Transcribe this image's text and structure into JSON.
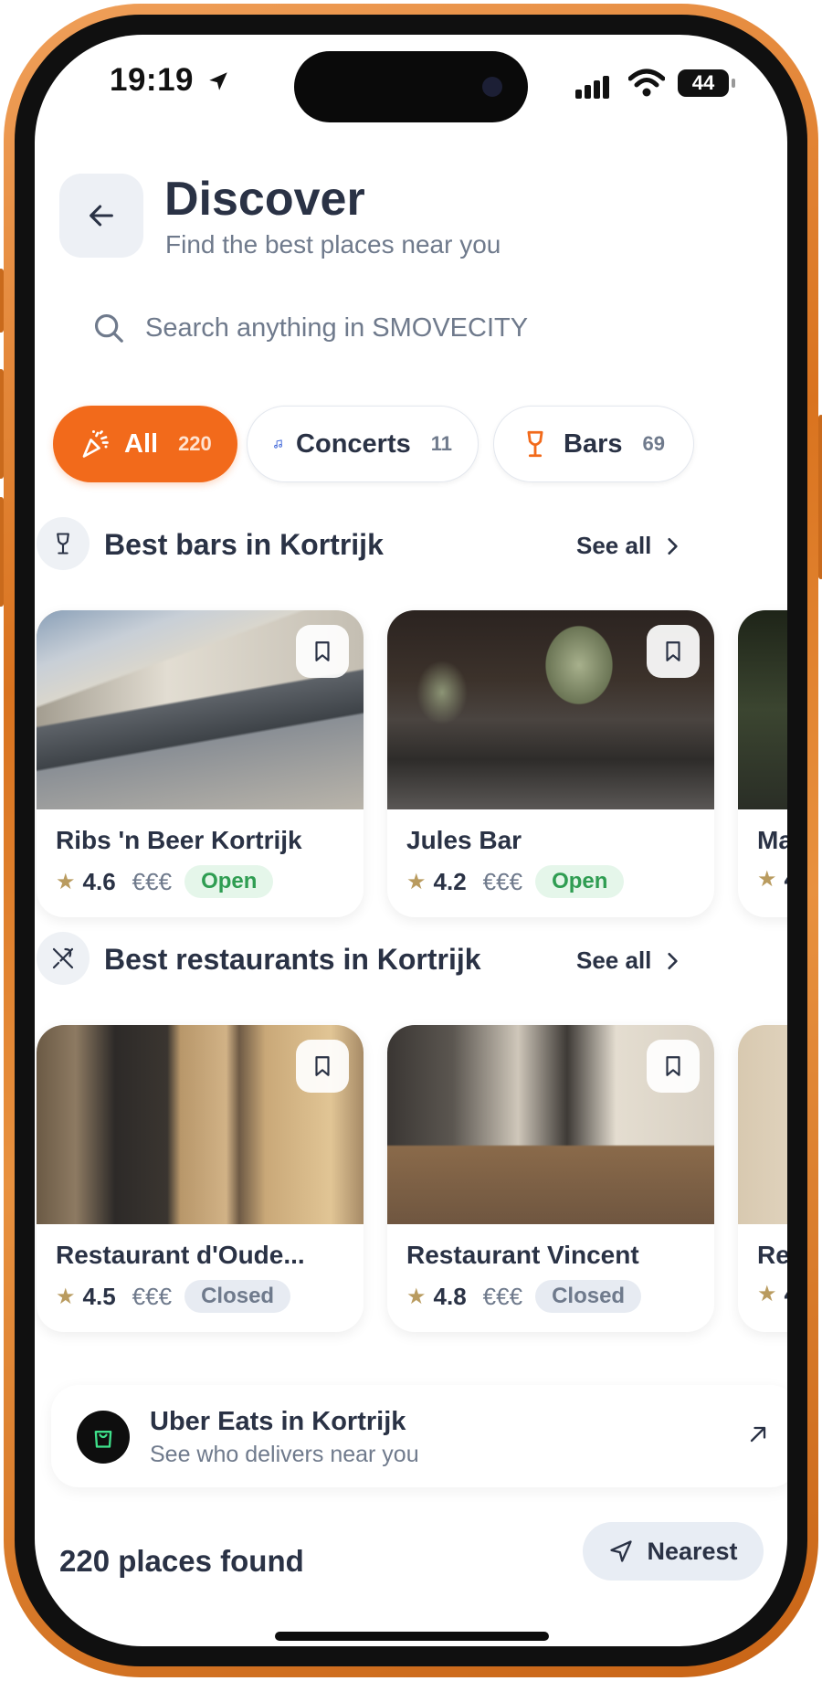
{
  "status_bar": {
    "time": "19:19",
    "battery": "44"
  },
  "header": {
    "title": "Discover",
    "subtitle": "Find the best places near you"
  },
  "search": {
    "placeholder": "Search anything in SMOVECITY"
  },
  "filters": [
    {
      "label": "All",
      "count": "220",
      "icon": "party-popper-icon",
      "active": true
    },
    {
      "label": "Concerts",
      "count": "11",
      "icon": "music-note-icon",
      "active": false
    },
    {
      "label": "Bars",
      "count": "69",
      "icon": "wine-glass-icon",
      "active": false
    }
  ],
  "sections": {
    "bars": {
      "title": "Best bars in Kortrijk",
      "see_all": "See all",
      "cards": [
        {
          "name": "Ribs 'n Beer Kortrijk",
          "rating": "4.6",
          "price": "€€€",
          "status": "Open"
        },
        {
          "name": "Jules Bar",
          "rating": "4.2",
          "price": "€€€",
          "status": "Open"
        },
        {
          "name": "Ma",
          "rating": "4",
          "price": "",
          "status": ""
        }
      ]
    },
    "restaurants": {
      "title": "Best restaurants in Kortrijk",
      "see_all": "See all",
      "cards": [
        {
          "name": "Restaurant d'Oude...",
          "rating": "4.5",
          "price": "€€€",
          "status": "Closed"
        },
        {
          "name": "Restaurant Vincent",
          "rating": "4.8",
          "price": "€€€",
          "status": "Closed"
        },
        {
          "name": "Res",
          "rating": "4",
          "price": "",
          "status": ""
        }
      ]
    }
  },
  "uber_eats": {
    "title": "Uber Eats in Kortrijk",
    "subtitle": "See who delivers near you"
  },
  "results": {
    "count_label": "220 places found",
    "sort_label": "Nearest"
  },
  "colors": {
    "accent": "#f26a1b",
    "text": "#2a3245",
    "muted": "#6f7a8c",
    "open_bg": "#e5f6ea",
    "open_text": "#2f9d52",
    "closed_bg": "#e7ebf2"
  }
}
